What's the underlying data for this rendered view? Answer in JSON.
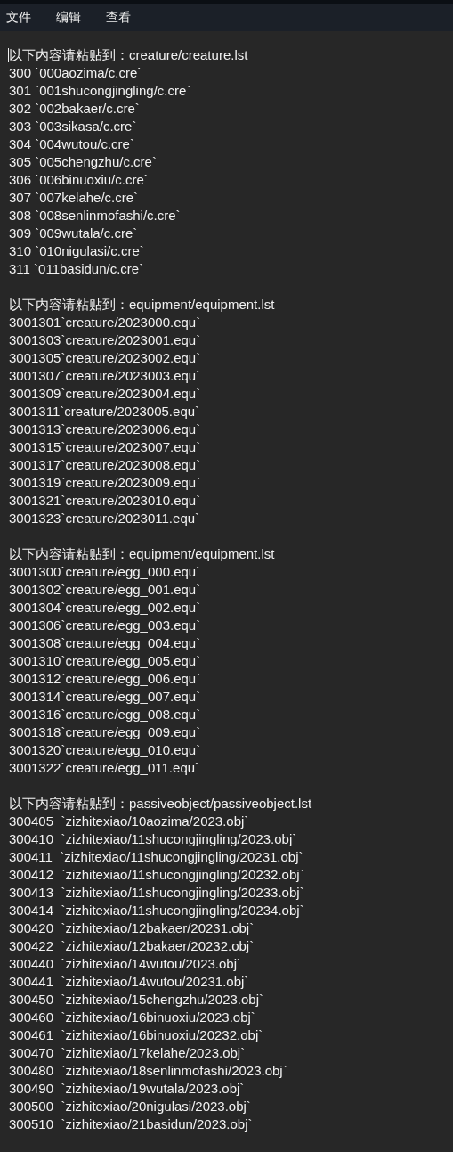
{
  "menu": [
    {
      "label": "文件"
    },
    {
      "label": "编辑"
    },
    {
      "label": "查看"
    }
  ],
  "editor": {
    "sections": [
      {
        "header": "以下内容请粘贴到：creature/creature.lst",
        "lines": [
          "300 `000aozima/c.cre`",
          "301 `001shucongjingling/c.cre`",
          "302 `002bakaer/c.cre`",
          "303 `003sikasa/c.cre`",
          "304 `004wutou/c.cre`",
          "305 `005chengzhu/c.cre`",
          "306 `006binuoxiu/c.cre`",
          "307 `007kelahe/c.cre`",
          "308 `008senlinmofashi/c.cre`",
          "309 `009wutala/c.cre`",
          "310 `010nigulasi/c.cre`",
          "311 `011basidun/c.cre`"
        ]
      },
      {
        "header": "以下内容请粘贴到：equipment/equipment.lst",
        "lines": [
          "3001301`creature/2023000.equ`",
          "3001303`creature/2023001.equ`",
          "3001305`creature/2023002.equ`",
          "3001307`creature/2023003.equ`",
          "3001309`creature/2023004.equ`",
          "3001311`creature/2023005.equ`",
          "3001313`creature/2023006.equ`",
          "3001315`creature/2023007.equ`",
          "3001317`creature/2023008.equ`",
          "3001319`creature/2023009.equ`",
          "3001321`creature/2023010.equ`",
          "3001323`creature/2023011.equ`"
        ]
      },
      {
        "header": "以下内容请粘贴到：equipment/equipment.lst",
        "lines": [
          "3001300`creature/egg_000.equ`",
          "3001302`creature/egg_001.equ`",
          "3001304`creature/egg_002.equ`",
          "3001306`creature/egg_003.equ`",
          "3001308`creature/egg_004.equ`",
          "3001310`creature/egg_005.equ`",
          "3001312`creature/egg_006.equ`",
          "3001314`creature/egg_007.equ`",
          "3001316`creature/egg_008.equ`",
          "3001318`creature/egg_009.equ`",
          "3001320`creature/egg_010.equ`",
          "3001322`creature/egg_011.equ`"
        ]
      },
      {
        "header": "以下内容请粘贴到：passiveobject/passiveobject.lst",
        "lines": [
          "300405  `zizhitexiao/10aozima/2023.obj`",
          "300410  `zizhitexiao/11shucongjingling/2023.obj`",
          "300411  `zizhitexiao/11shucongjingling/20231.obj`",
          "300412  `zizhitexiao/11shucongjingling/20232.obj`",
          "300413  `zizhitexiao/11shucongjingling/20233.obj`",
          "300414  `zizhitexiao/11shucongjingling/20234.obj`",
          "300420  `zizhitexiao/12bakaer/20231.obj`",
          "300422  `zizhitexiao/12bakaer/20232.obj`",
          "300440  `zizhitexiao/14wutou/2023.obj`",
          "300441  `zizhitexiao/14wutou/20231.obj`",
          "300450  `zizhitexiao/15chengzhu/2023.obj`",
          "300460  `zizhitexiao/16binuoxiu/2023.obj`",
          "300461  `zizhitexiao/16binuoxiu/20232.obj`",
          "300470  `zizhitexiao/17kelahe/2023.obj`",
          "300480  `zizhitexiao/18senlinmofashi/2023.obj`",
          "300490  `zizhitexiao/19wutala/2023.obj`",
          "300500  `zizhitexiao/20nigulasi/2023.obj`",
          "300510  `zizhitexiao/21basidun/2023.obj`"
        ]
      }
    ]
  }
}
